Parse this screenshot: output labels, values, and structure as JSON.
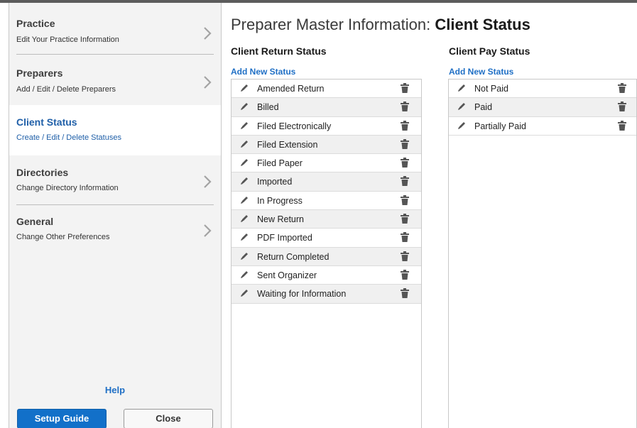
{
  "sidebar": {
    "items": [
      {
        "title": "Practice",
        "subtitle": "Edit Your Practice Information"
      },
      {
        "title": "Preparers",
        "subtitle": "Add / Edit / Delete Preparers"
      },
      {
        "title": "Client Status",
        "subtitle": "Create / Edit / Delete Statuses"
      },
      {
        "title": "Directories",
        "subtitle": "Change Directory Information"
      },
      {
        "title": "General",
        "subtitle": "Change Other Preferences"
      }
    ],
    "help_label": "Help",
    "setup_guide_label": "Setup Guide",
    "close_label": "Close"
  },
  "main": {
    "title_prefix": "Preparer Master Information: ",
    "title_bold": "Client Status",
    "return_status": {
      "heading": "Client Return Status",
      "add_label": "Add New Status",
      "items": [
        "Amended Return",
        "Billed",
        "Filed Electronically",
        "Filed Extension",
        "Filed Paper",
        "Imported",
        "In Progress",
        "New Return",
        "PDF Imported",
        "Return Completed",
        "Sent Organizer",
        "Waiting for Information"
      ]
    },
    "pay_status": {
      "heading": "Client Pay Status",
      "add_label": "Add New Status",
      "items": [
        "Not Paid",
        "Paid",
        "Partially Paid"
      ]
    }
  },
  "colors": {
    "accent": "#1270c9",
    "link": "#1f6fc5",
    "active_nav": "#1f5fa8",
    "sidebar_bg": "#f3f3f3",
    "row_alt": "#f0f0f0",
    "icon": "#555555"
  },
  "icons": {
    "nav_arrow": "chevron-right-icon",
    "row_edit": "pencil-icon",
    "row_delete": "trash-icon"
  }
}
